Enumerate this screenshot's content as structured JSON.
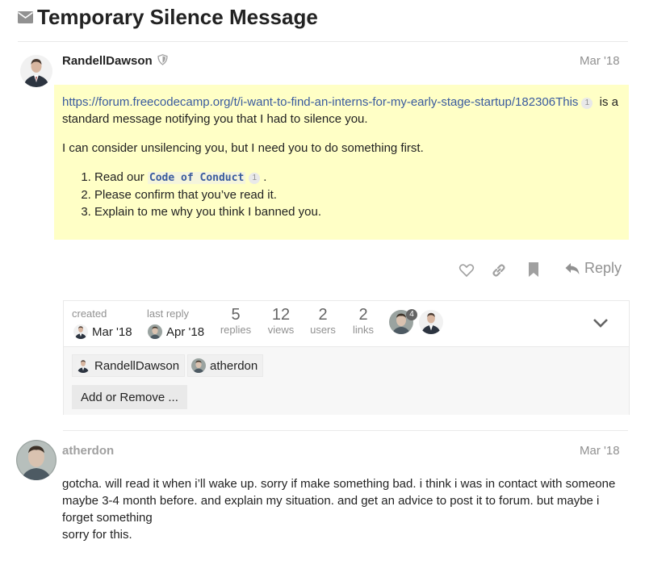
{
  "topic": {
    "title": "Temporary Silence Message",
    "icon": "envelope-icon"
  },
  "post1": {
    "username": "RandellDawson",
    "date": "Mar '18",
    "link_text": "https://forum.freecodecamp.org/t/i-want-to-find-an-interns-for-my-early-stage-startup/182306This",
    "link_count": "1",
    "p1_rest": " is a",
    "p1_line2": "standard message notifying you that I had to silence you.",
    "p2": "I can consider unsilencing you, but I need you to do something first.",
    "list": [
      {
        "prefix": "Read our ",
        "code": "Code of Conduct",
        "count": "1",
        "suffix": "."
      },
      {
        "text": "Please confirm that you’ve read it."
      },
      {
        "text": "Explain to me why you think I banned you."
      }
    ],
    "actions": {
      "like": "heart-icon",
      "share": "link-icon",
      "bookmark": "bookmark-icon",
      "reply_label": "Reply"
    }
  },
  "topic_map": {
    "created_label": "created",
    "created_date": "Mar '18",
    "last_reply_label": "last reply",
    "last_reply_date": "Apr '18",
    "stats": [
      {
        "num": "5",
        "label": "replies"
      },
      {
        "num": "12",
        "label": "views"
      },
      {
        "num": "2",
        "label": "users"
      },
      {
        "num": "2",
        "label": "links"
      }
    ],
    "participant_badge": "4",
    "participants": [
      "RandellDawson",
      "atherdon"
    ],
    "add_remove_label": "Add or Remove ..."
  },
  "post2": {
    "username": "atherdon",
    "date": "Mar '18",
    "line1": "gotcha. will read it when i’ll wake up. sorry if make something bad. i think i was in contact with someone",
    "line2": "maybe 3-4 month before. and explain my situation. and get an advice to post it to forum. but maybe i",
    "line3": "forget something",
    "line4": "sorry for this."
  }
}
